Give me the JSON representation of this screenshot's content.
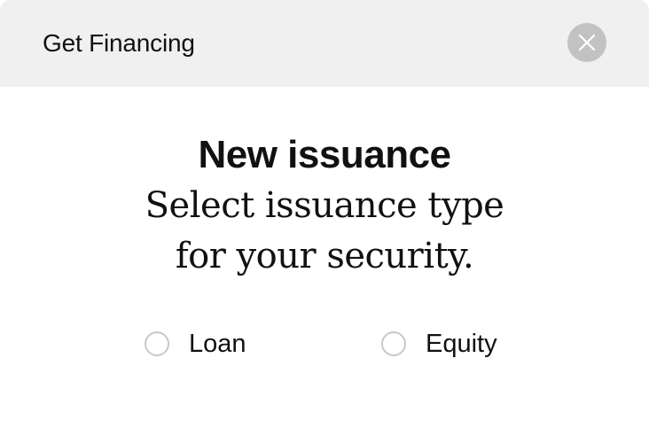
{
  "dialog": {
    "title": "Get Financing",
    "close_icon": "close-icon"
  },
  "content": {
    "heading": "New issuance",
    "subheading_line1": "Select issuance type",
    "subheading_line2": "for your security."
  },
  "options": [
    {
      "label": "Loan",
      "selected": false
    },
    {
      "label": "Equity",
      "selected": false
    }
  ],
  "colors": {
    "header_background": "#f0f0f0",
    "close_button_background": "#c2c2c2",
    "text": "#111111",
    "radio_border": "#c8c8c8"
  }
}
